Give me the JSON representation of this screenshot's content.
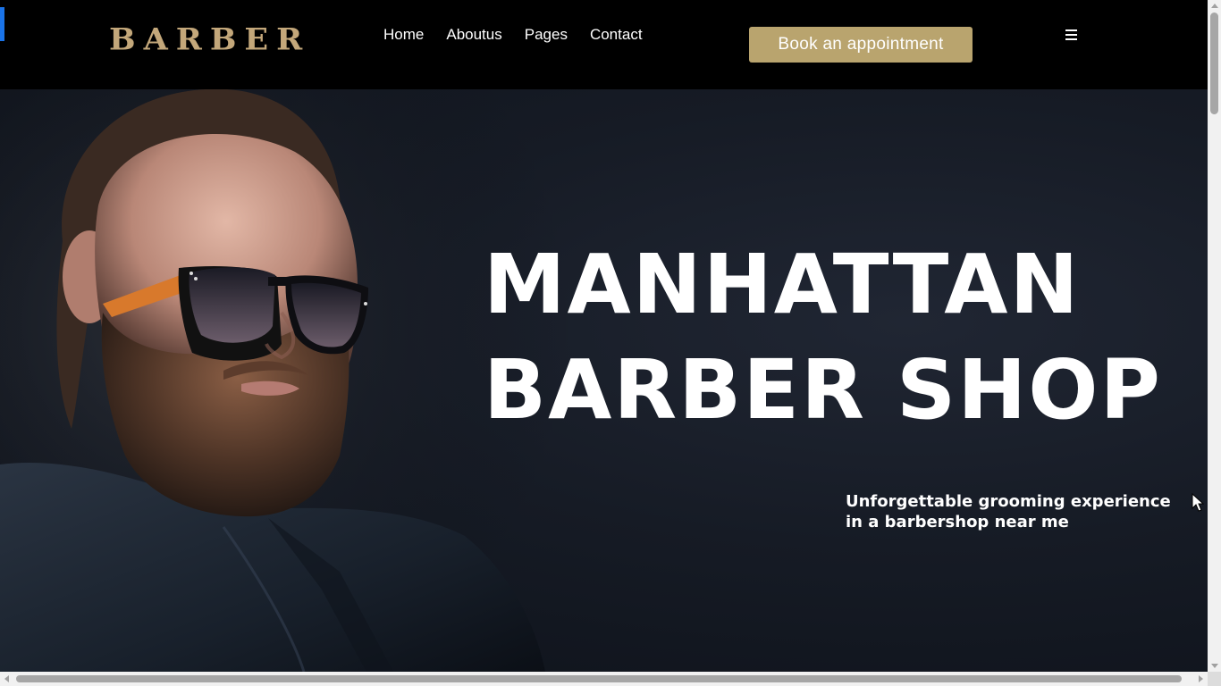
{
  "header": {
    "logo": "BARBER",
    "nav": [
      "Home",
      "Aboutus",
      "Pages",
      "Contact"
    ],
    "cta_label": "Book an appointment",
    "menu_icon": "hamburger-menu-icon"
  },
  "hero": {
    "title_line1": "MANHATTAN",
    "title_line2": "BARBER SHOP",
    "subtitle": "Unforgettable grooming experience in a barbershop near me",
    "image": "bearded-man-sunglasses-portrait"
  },
  "colors": {
    "accent": "#b9a46e",
    "logo": "#c3a77a",
    "header_bg": "#000000",
    "hero_bg": "#161b25",
    "loader": "#1a73e8"
  }
}
